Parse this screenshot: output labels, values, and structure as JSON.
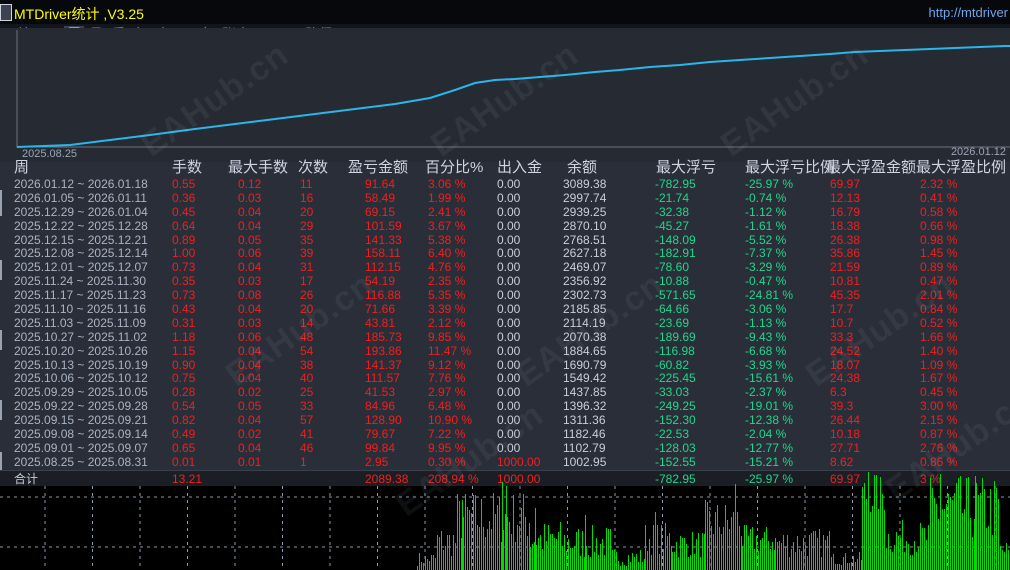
{
  "title_bar": {
    "title": "MTDriver统计 ,V3.25",
    "url": "http://mtdriver"
  },
  "menu": {
    "items": [
      "综",
      "日",
      "周",
      "月",
      "季",
      "年",
      "巾",
      "M",
      "备",
      "账户"
    ],
    "active_index": 2,
    "path_label": "路径"
  },
  "watermark_text": "EAHub.cn",
  "equity_chart": {
    "type": "line",
    "start_label": "2025.08.25",
    "end_label": "2026.01.12",
    "line_color": "#29b6ea",
    "points": [
      [
        17,
        147
      ],
      [
        70,
        145
      ],
      [
        110,
        140
      ],
      [
        150,
        135
      ],
      [
        195,
        129
      ],
      [
        235,
        124
      ],
      [
        275,
        119
      ],
      [
        315,
        114
      ],
      [
        355,
        109
      ],
      [
        395,
        104
      ],
      [
        430,
        98
      ],
      [
        455,
        90
      ],
      [
        475,
        83
      ],
      [
        495,
        80
      ],
      [
        515,
        79
      ],
      [
        540,
        77
      ],
      [
        565,
        75
      ],
      [
        595,
        72
      ],
      [
        620,
        70
      ],
      [
        650,
        67
      ],
      [
        680,
        65
      ],
      [
        710,
        62
      ],
      [
        740,
        60
      ],
      [
        770,
        58
      ],
      [
        800,
        56
      ],
      [
        830,
        54
      ],
      [
        855,
        52
      ],
      [
        880,
        51
      ],
      [
        905,
        50
      ],
      [
        930,
        49
      ],
      [
        955,
        48
      ],
      [
        980,
        47
      ],
      [
        1005,
        46
      ],
      [
        1010,
        46
      ]
    ]
  },
  "table": {
    "headers": [
      "周",
      "手数",
      "最大手数",
      "次数",
      "盈亏金额",
      "百分比%",
      "出入金",
      "余额",
      "最大浮亏",
      "最大浮亏比例",
      "最大浮盈金额",
      "最大浮盈比例"
    ],
    "rows": [
      [
        "2026.01.12 ~ 2026.01.18",
        "0.55",
        "0.12",
        "11",
        "91.64",
        "3.06 %",
        "0.00",
        "3089.38",
        "-782.95",
        "-25.97 %",
        "69.97",
        "2.32 %"
      ],
      [
        "2026.01.05 ~ 2026.01.11",
        "0.36",
        "0.03",
        "16",
        "58.49",
        "1.99 %",
        "0.00",
        "2997.74",
        "-21.74",
        "-0.74 %",
        "12.13",
        "0.41 %"
      ],
      [
        "2025.12.29 ~ 2026.01.04",
        "0.45",
        "0.04",
        "20",
        "69.15",
        "2.41 %",
        "0.00",
        "2939.25",
        "-32.38",
        "-1.12 %",
        "16.79",
        "0.58 %"
      ],
      [
        "2025.12.22 ~ 2025.12.28",
        "0.64",
        "0.04",
        "29",
        "101.59",
        "3.67 %",
        "0.00",
        "2870.10",
        "-45.27",
        "-1.61 %",
        "18.38",
        "0.66 %"
      ],
      [
        "2025.12.15 ~ 2025.12.21",
        "0.89",
        "0.05",
        "35",
        "141.33",
        "5.38 %",
        "0.00",
        "2768.51",
        "-148.09",
        "-5.52 %",
        "26.38",
        "0.98 %"
      ],
      [
        "2025.12.08 ~ 2025.12.14",
        "1.00",
        "0.06",
        "39",
        "158.11",
        "6.40 %",
        "0.00",
        "2627.18",
        "-182.91",
        "-7.37 %",
        "35.86",
        "1.45 %"
      ],
      [
        "2025.12.01 ~ 2025.12.07",
        "0.73",
        "0.04",
        "31",
        "112.15",
        "4.76 %",
        "0.00",
        "2469.07",
        "-78.60",
        "-3.29 %",
        "21.59",
        "0.89 %"
      ],
      [
        "2025.11.24 ~ 2025.11.30",
        "0.35",
        "0.03",
        "17",
        "54.19",
        "2.35 %",
        "0.00",
        "2356.92",
        "-10.88",
        "-0.47 %",
        "10.81",
        "0.47 %"
      ],
      [
        "2025.11.17 ~ 2025.11.23",
        "0.73",
        "0.08",
        "26",
        "116.88",
        "5.35 %",
        "0.00",
        "2302.73",
        "-571.65",
        "-24.81 %",
        "45.35",
        "2.01 %"
      ],
      [
        "2025.11.10 ~ 2025.11.16",
        "0.43",
        "0.04",
        "20",
        "71.66",
        "3.39 %",
        "0.00",
        "2185.85",
        "-64.66",
        "-3.06 %",
        "17.7",
        "0.84 %"
      ],
      [
        "2025.11.03 ~ 2025.11.09",
        "0.31",
        "0.03",
        "14",
        "43.81",
        "2.12 %",
        "0.00",
        "2114.19",
        "-23.69",
        "-1.13 %",
        "10.7",
        "0.52 %"
      ],
      [
        "2025.10.27 ~ 2025.11.02",
        "1.18",
        "0.06",
        "48",
        "185.73",
        "9.85 %",
        "0.00",
        "2070.38",
        "-189.69",
        "-9.43 %",
        "33.3",
        "1.66 %"
      ],
      [
        "2025.10.20 ~ 2025.10.26",
        "1.15",
        "0.04",
        "54",
        "193.86",
        "11.47 %",
        "0.00",
        "1884.65",
        "-116.98",
        "-6.68 %",
        "24.52",
        "1.40 %"
      ],
      [
        "2025.10.13 ~ 2025.10.19",
        "0.90",
        "0.04",
        "38",
        "141.37",
        "9.12 %",
        "0.00",
        "1690.79",
        "-60.82",
        "-3.93 %",
        "18.07",
        "1.09 %"
      ],
      [
        "2025.10.06 ~ 2025.10.12",
        "0.75",
        "0.04",
        "40",
        "111.57",
        "7.76 %",
        "0.00",
        "1549.42",
        "-225.45",
        "-15.61 %",
        "24.38",
        "1.67 %"
      ],
      [
        "2025.09.29 ~ 2025.10.05",
        "0.28",
        "0.02",
        "25",
        "41.53",
        "2.97 %",
        "0.00",
        "1437.85",
        "-33.03",
        "-2.37 %",
        "6.3",
        "0.45 %"
      ],
      [
        "2025.09.22 ~ 2025.09.28",
        "0.54",
        "0.05",
        "33",
        "84.96",
        "6.48 %",
        "0.00",
        "1396.32",
        "-249.25",
        "-19.01 %",
        "39.3",
        "3.00 %"
      ],
      [
        "2025.09.15 ~ 2025.09.21",
        "0.82",
        "0.04",
        "57",
        "128.90",
        "10.90 %",
        "0.00",
        "1311.36",
        "-152.30",
        "-12.38 %",
        "26.44",
        "2.15 %"
      ],
      [
        "2025.09.08 ~ 2025.09.14",
        "0.49",
        "0.02",
        "41",
        "79.67",
        "7.22 %",
        "0.00",
        "1182.46",
        "-22.53",
        "-2.04 %",
        "10.18",
        "0.87 %"
      ],
      [
        "2025.09.01 ~ 2025.09.07",
        "0.65",
        "0.04",
        "46",
        "99.84",
        "9.95 %",
        "0.00",
        "1102.79",
        "-128.03",
        "-12.77 %",
        "27.71",
        "2.76 %"
      ],
      [
        "2025.08.25 ~ 2025.08.31",
        "0.01",
        "0.01",
        "1",
        "2.95",
        "0.30 %",
        "1000.00",
        "1002.95",
        "-152.55",
        "-15.21 %",
        "8.62",
        "0.86 %"
      ]
    ],
    "total": [
      "合计",
      "13.21",
      "",
      "",
      "2089.38",
      "208.94 %",
      "1000.00",
      "",
      "-782.95",
      "-25.97 %",
      "69.97",
      "3 %"
    ]
  },
  "volume_chart": {
    "type": "bar",
    "bar_color": "#00dc00",
    "clusters": [
      {
        "from": 417,
        "to": 437,
        "min": 4,
        "max": 18
      },
      {
        "from": 437,
        "to": 457,
        "min": 12,
        "max": 45
      },
      {
        "from": 457,
        "to": 530,
        "min": 25,
        "max": 80
      },
      {
        "from": 530,
        "to": 562,
        "min": 12,
        "max": 50
      },
      {
        "from": 562,
        "to": 612,
        "min": 10,
        "max": 45
      },
      {
        "from": 612,
        "to": 645,
        "min": 4,
        "max": 22
      },
      {
        "from": 645,
        "to": 672,
        "min": 15,
        "max": 48
      },
      {
        "from": 672,
        "to": 705,
        "min": 12,
        "max": 40
      },
      {
        "from": 705,
        "to": 742,
        "min": 25,
        "max": 70
      },
      {
        "from": 742,
        "to": 775,
        "min": 15,
        "max": 45
      },
      {
        "from": 775,
        "to": 835,
        "min": 12,
        "max": 42
      },
      {
        "from": 835,
        "to": 862,
        "min": 5,
        "max": 18
      },
      {
        "from": 862,
        "to": 886,
        "min": 55,
        "max": 96
      },
      {
        "from": 886,
        "to": 930,
        "min": 15,
        "max": 50
      },
      {
        "from": 930,
        "to": 1000,
        "min": 28,
        "max": 95
      },
      {
        "from": 1000,
        "to": 1010,
        "min": 8,
        "max": 30
      }
    ],
    "spikes": [
      [
        502,
        88
      ],
      [
        506,
        84
      ],
      [
        462,
        70
      ],
      [
        535,
        62
      ],
      [
        585,
        55
      ],
      [
        655,
        58
      ],
      [
        735,
        86
      ],
      [
        868,
        98
      ],
      [
        874,
        95
      ],
      [
        940,
        96
      ],
      [
        958,
        92
      ],
      [
        975,
        94
      ]
    ]
  },
  "colors": {
    "bg-main": "#2a2e38",
    "bg-title": "#06080c",
    "bg-menu": "#12151c",
    "bg-chart": "#262a33",
    "bg-total": "#1b1e25",
    "bg-vol": "#000000",
    "yellow": "#ffff00",
    "url-blue": "#6ea6e8",
    "menu-text": "#7d8694",
    "header-text": "#cdd4e2",
    "text-dim": "#a9b4c4",
    "text-gray": "#c7cedb",
    "red": "#ef2020",
    "green": "#1fd88a",
    "label": "#9aa4b5",
    "line-blue": "#29b6ea",
    "vol-green": "#00dc00",
    "grid": "#8b97ad"
  }
}
